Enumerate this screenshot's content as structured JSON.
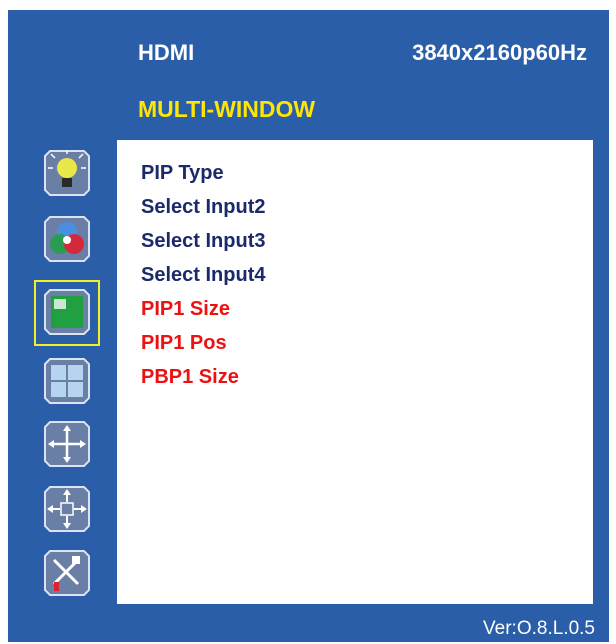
{
  "header": {
    "input_source": "HDMI",
    "resolution": "3840x2160p60Hz"
  },
  "menu_title": "MULTI-WINDOW",
  "sidebar": {
    "items": [
      {
        "icon": "brightness-bulb-icon",
        "selected": false
      },
      {
        "icon": "color-rgb-icon",
        "selected": false
      },
      {
        "icon": "pip-window-icon",
        "selected": true
      },
      {
        "icon": "multi-window-grid-icon",
        "selected": false
      },
      {
        "icon": "position-arrows-icon",
        "selected": false
      },
      {
        "icon": "size-arrows-icon",
        "selected": false
      },
      {
        "icon": "setup-tools-icon",
        "selected": false
      }
    ]
  },
  "menu": {
    "items": [
      {
        "label": "PIP Type",
        "enabled": true
      },
      {
        "label": "Select Input2",
        "enabled": true
      },
      {
        "label": "Select Input3",
        "enabled": true
      },
      {
        "label": "Select Input4",
        "enabled": true
      },
      {
        "label": "PIP1 Size",
        "enabled": false
      },
      {
        "label": "PIP1 Pos",
        "enabled": false
      },
      {
        "label": "PBP1 Size",
        "enabled": false
      }
    ]
  },
  "version": "Ver:O.8.L.0.5",
  "colors": {
    "background": "#2a5ea8",
    "title": "#ffe600",
    "enabled_text": "#1b2a6b",
    "disabled_text": "#ee1111",
    "selection_frame": "#f2ef2a"
  }
}
